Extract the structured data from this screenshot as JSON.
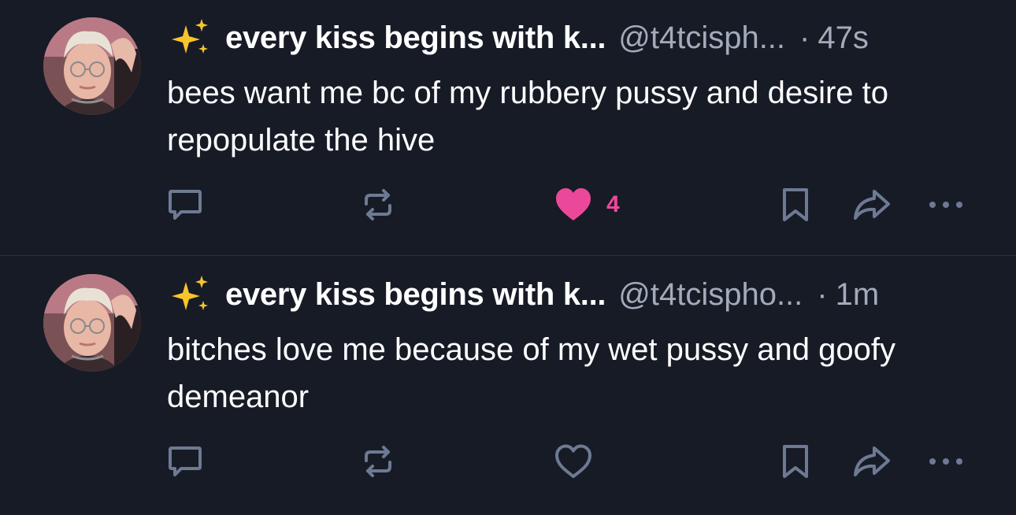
{
  "posts": [
    {
      "display_name": "every kiss begins with k...",
      "handle": "@t4tcisph...",
      "separator": "·",
      "time": "47s",
      "text": "bees want me bc of my rubbery pussy and desire to repopulate the hive",
      "liked": true,
      "like_count": "4"
    },
    {
      "display_name": "every kiss begins with k...",
      "handle": "@t4tcispho...",
      "separator": "·",
      "time": "1m",
      "text": "bitches love me because of my wet pussy and goofy demeanor",
      "liked": false,
      "like_count": ""
    }
  ],
  "colors": {
    "background": "#161b26",
    "text": "#ffffff",
    "muted": "#a3abbb",
    "icon": "#6e7a93",
    "like": "#ec4899",
    "divider": "#2c3240"
  },
  "icons": {
    "name_prefix": "sparkles-icon",
    "reply": "speech-bubble-icon",
    "repost": "repost-icon",
    "like": "heart-icon",
    "bookmark": "bookmark-icon",
    "share": "share-arrow-icon",
    "more": "ellipsis-icon"
  }
}
